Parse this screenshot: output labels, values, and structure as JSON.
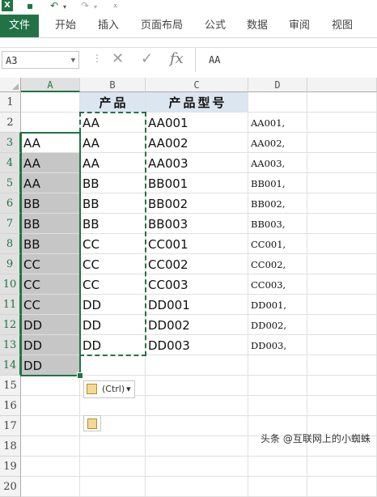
{
  "window": {
    "app_logo": "X",
    "qat_icons": [
      "save-icon",
      "undo-icon",
      "redo-icon",
      "customize-icon"
    ],
    "tabs": [
      "文件",
      "开始",
      "插入",
      "页面布局",
      "公式",
      "数据",
      "审阅",
      "视图"
    ]
  },
  "formula_bar": {
    "name_box": "A3",
    "separator": "⋮",
    "cancel_glyph": "✕",
    "enter_glyph": "✓",
    "fx_label": "fx",
    "content": "AA"
  },
  "sheet": {
    "columns": [
      "A",
      "B",
      "C",
      "D"
    ],
    "selected_column": "A",
    "rows": [
      {
        "n": "1",
        "a": "",
        "b": "产品",
        "c": "产品型号",
        "d": ""
      },
      {
        "n": "2",
        "a": "",
        "b": "AA",
        "c": "AA001",
        "d": "AA001,"
      },
      {
        "n": "3",
        "a": "AA",
        "b": "AA",
        "c": "AA002",
        "d": "AA002,"
      },
      {
        "n": "4",
        "a": "AA",
        "b": "AA",
        "c": "AA003",
        "d": "AA003,"
      },
      {
        "n": "5",
        "a": "AA",
        "b": "BB",
        "c": "BB001",
        "d": "BB001,"
      },
      {
        "n": "6",
        "a": "BB",
        "b": "BB",
        "c": "BB002",
        "d": "BB002,"
      },
      {
        "n": "7",
        "a": "BB",
        "b": "BB",
        "c": "BB003",
        "d": "BB003,"
      },
      {
        "n": "8",
        "a": "BB",
        "b": "CC",
        "c": "CC001",
        "d": "CC001,"
      },
      {
        "n": "9",
        "a": "CC",
        "b": "CC",
        "c": "CC002",
        "d": "CC002,"
      },
      {
        "n": "10",
        "a": "CC",
        "b": "CC",
        "c": "CC003",
        "d": "CC003,"
      },
      {
        "n": "11",
        "a": "CC",
        "b": "DD",
        "c": "DD001",
        "d": "DD001,"
      },
      {
        "n": "12",
        "a": "DD",
        "b": "DD",
        "c": "DD002",
        "d": "DD002,"
      },
      {
        "n": "13",
        "a": "DD",
        "b": "DD",
        "c": "DD003",
        "d": "DD003,"
      },
      {
        "n": "14",
        "a": "DD",
        "b": "",
        "c": "",
        "d": ""
      },
      {
        "n": "15",
        "a": "",
        "b": "",
        "c": "",
        "d": ""
      },
      {
        "n": "16",
        "a": "",
        "b": "",
        "c": "",
        "d": ""
      },
      {
        "n": "17",
        "a": "",
        "b": "",
        "c": "",
        "d": ""
      },
      {
        "n": "18",
        "a": "",
        "b": "",
        "c": "",
        "d": ""
      },
      {
        "n": "19",
        "a": "",
        "b": "",
        "c": "",
        "d": ""
      },
      {
        "n": "20",
        "a": "",
        "b": "",
        "c": "",
        "d": ""
      }
    ]
  },
  "paste_options": {
    "label": "(Ctrl)",
    "arrow": "▾"
  },
  "watermark": "头条 @互联网上的小蜘蛛",
  "colors": {
    "accent": "#217346",
    "header_fill": "#dce6f1",
    "selection_fill": "#c6c6c6"
  }
}
